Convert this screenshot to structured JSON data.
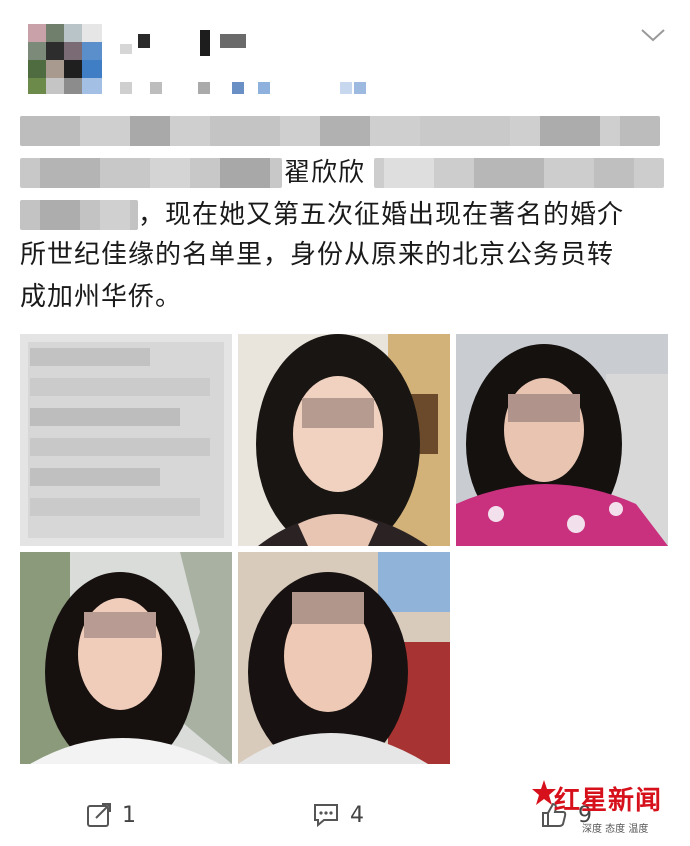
{
  "post": {
    "text_line2_fragment": "翟欣欣",
    "text_line3": "，现在她又第五次征婚出现在著名的婚介",
    "text_line4": "所世纪佳缘的名单里，身份从原来的北京公务员转",
    "text_line5": "成加州华侨。"
  },
  "footer": {
    "share_count": "1",
    "comment_count": "4",
    "like_count": "9"
  },
  "watermark": {
    "brand": "红星新闻",
    "slogan": "深度 态度 温度"
  },
  "icons": {
    "menu": "chevron-down-icon",
    "share": "share-icon",
    "comment": "comment-icon",
    "like": "thumbs-up-icon"
  },
  "colors": {
    "text": "#1a1a1a",
    "brand_red": "#d6111b"
  }
}
